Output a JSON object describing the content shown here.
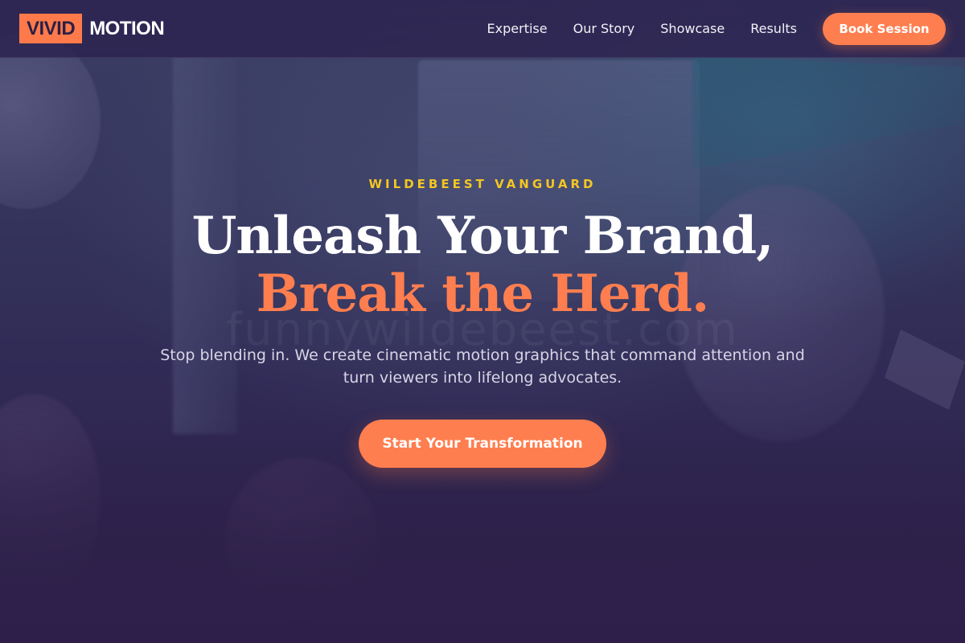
{
  "brand": {
    "logo_box": "VIVID",
    "logo_text": "MOTION",
    "accent_color": "#ff7e4f"
  },
  "nav": {
    "items": [
      {
        "label": "Expertise"
      },
      {
        "label": "Our Story"
      },
      {
        "label": "Showcase"
      },
      {
        "label": "Results"
      }
    ],
    "cta_label": "Book Session"
  },
  "hero": {
    "eyebrow": "WILDEBEEST VANGUARD",
    "headline_line1": "Unleash Your Brand,",
    "headline_line2": "Break the Herd.",
    "subtext": "Stop blending in. We create cinematic motion graphics that command attention and turn viewers into lifelong advocates.",
    "cta_label": "Start Your Transformation",
    "watermark": "funnywildebeest.com"
  }
}
